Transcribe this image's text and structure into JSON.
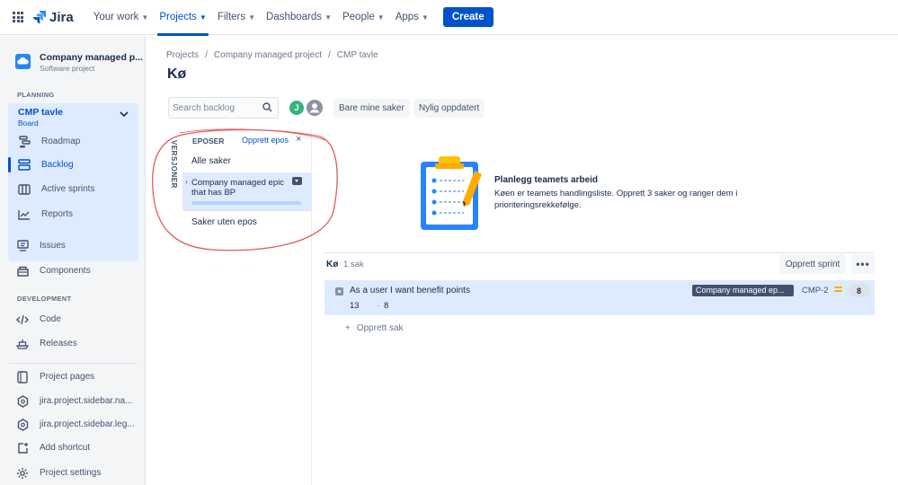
{
  "topnav": {
    "logo": "Jira",
    "items": [
      {
        "label": "Your work"
      },
      {
        "label": "Projects"
      },
      {
        "label": "Filters"
      },
      {
        "label": "Dashboards"
      },
      {
        "label": "People"
      },
      {
        "label": "Apps"
      }
    ],
    "create": "Create"
  },
  "sidebar": {
    "project_name": "Company managed p...",
    "project_type": "Software project",
    "planning_title": "PLANNING",
    "board_name": "CMP tavle",
    "board_sub": "Board",
    "planning_items": [
      {
        "label": "Roadmap"
      },
      {
        "label": "Backlog"
      },
      {
        "label": "Active sprints"
      },
      {
        "label": "Reports"
      }
    ],
    "other_items": [
      {
        "label": "Issues"
      },
      {
        "label": "Components"
      }
    ],
    "development_title": "DEVELOPMENT",
    "dev_items": [
      {
        "label": "Code"
      },
      {
        "label": "Releases"
      }
    ],
    "footer_items": [
      {
        "label": "Project pages"
      },
      {
        "label": "jira.project.sidebar.na..."
      },
      {
        "label": "jira.project.sidebar.leg..."
      },
      {
        "label": "Add shortcut"
      },
      {
        "label": "Project settings"
      }
    ]
  },
  "breadcrumb": [
    "Projects",
    "/",
    "Company managed project",
    "/",
    "CMP tavle"
  ],
  "page_title": "Kø",
  "search": {
    "placeholder": "Search backlog"
  },
  "avatar_initial": "J",
  "filters": [
    "Bare mine saker",
    "Nylig oppdatert"
  ],
  "epic_panel": {
    "versions_tab": "VERSJONER",
    "header": "EPOSER",
    "create": "Opprett epos",
    "close": "×",
    "all": "Alle saker",
    "epic_name": "Company managed epic that has BP",
    "without": "Saker uten epos"
  },
  "empty_state": {
    "title": "Planlegg teamets arbeid",
    "desc": "Køen er teamets handlingsliste. Opprett 3 saker og ranger dem i prioriteringsrekkefølge."
  },
  "backlog": {
    "label": "Kø",
    "count": "1 sak",
    "sprint_button": "Opprett sprint",
    "more": "•••",
    "issue": {
      "summary": "As a user I want benefit points",
      "n1": "13",
      "dot": "·",
      "n2": "8",
      "epic": "Company managed ep...",
      "key": "CMP-2",
      "points": "8"
    },
    "create_issue": "Opprett sak",
    "create_plus": "+"
  }
}
